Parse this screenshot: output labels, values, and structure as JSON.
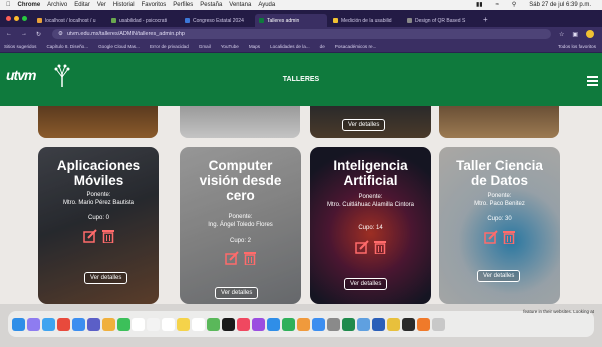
{
  "macos_menu": {
    "app": "Chrome",
    "items": [
      "Archivo",
      "Editar",
      "Ver",
      "Historial",
      "Favoritos",
      "Perfiles",
      "Pestaña",
      "Ventana",
      "Ayuda"
    ],
    "datetime": "Sáb 27 de jul 6:39 p.m."
  },
  "browser": {
    "tabs": [
      {
        "label": "localhost / localhost / u",
        "color": "#e8a23a"
      },
      {
        "label": "usabilidad - psicocrati",
        "color": "#6aa84f"
      },
      {
        "label": "Congreso Estatal 2024",
        "color": "#3c78d8"
      },
      {
        "label": "Talleres admin",
        "color": "#0f7a3d",
        "active": true
      },
      {
        "label": "Medición de la usabilid",
        "color": "#f1c232"
      },
      {
        "label": "Design of QR Based S",
        "color": "#888888"
      }
    ],
    "url": "utvm.edu.mx/talleres/ADMIN/talleres_admin.php",
    "bookmarks": [
      "Sitios sugeridos",
      "Capítulo 8. Diseño...",
      "Google Cloud Mas...",
      "Error de privacidad",
      "Gmail",
      "YouTube",
      "Maps",
      "Localidades de la...",
      "de",
      "Posacadémicos re...",
      "Todos los favoritos"
    ]
  },
  "site": {
    "logo": "utvm",
    "title": "TALLERES",
    "accent": "#0f7a3d"
  },
  "top_row": {
    "details_label": "Ver detalles"
  },
  "cards": [
    {
      "title": "Aplicaciones Móviles",
      "ponente_label": "Ponente:",
      "ponente": "Mtro. Mario Pérez Bautista",
      "cupo": "Cupo: 0",
      "details_label": "Ver detalles"
    },
    {
      "title": "Computer visión desde cero",
      "ponente_label": "Ponente:",
      "ponente": "Ing. Ángel Toledo Flores",
      "cupo": "Cupo: 2",
      "details_label": "Ver detalles"
    },
    {
      "title": "Inteligencia Artificial",
      "ponente_label": "Ponente:",
      "ponente": "Mtro. Cuitláhuac Alamilla Cintora",
      "cupo": "Cupo: 14",
      "details_label": "Ver detalles"
    },
    {
      "title": "Taller Ciencia de Datos",
      "ponente_label": "Ponente:",
      "ponente": "Mtro. Paco Benitez",
      "cupo": "Cupo: 30",
      "details_label": "Ver detalles"
    }
  ],
  "icons": {
    "edit": "edit-icon",
    "delete": "trash-icon",
    "edit_color": "#ff6b6b",
    "delete_color": "#ff6b6b"
  },
  "dock": {
    "background_note": "feature in their websites. Looking at"
  }
}
